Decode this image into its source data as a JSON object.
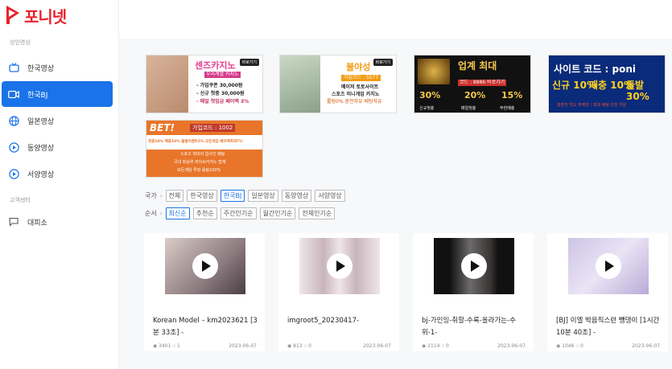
{
  "brand": {
    "logo_text": "포니넷",
    "accent": "#e8212b"
  },
  "sidebar": {
    "section1": "성인영상",
    "items": [
      {
        "label": "한국영상",
        "icon": "tv-icon"
      },
      {
        "label": "한국BJ",
        "icon": "video-camera-icon",
        "active": true
      },
      {
        "label": "일본영상",
        "icon": "globe-icon"
      },
      {
        "label": "동양영상",
        "icon": "play-circle-icon"
      },
      {
        "label": "서양영상",
        "icon": "play-circle-icon"
      }
    ],
    "section2": "고객센터",
    "support": {
      "label": "대피소",
      "icon": "chat-icon"
    }
  },
  "banners": [
    {
      "title": "센즈카지노",
      "sub": "우리계열 카지노",
      "lines": [
        "- 가입쿠폰 30,000원",
        "- 신규 첫충 30,000원",
        "- 매일 첫입금 페이백 3%"
      ],
      "btn": "바로가기"
    },
    {
      "title": "불야성",
      "sub": "가입코드 : 5577",
      "lines": [
        "메이저 토토사이트",
        "스포츠 미니게임 카지노",
        "롤링0% 완전자유 베팅자유"
      ],
      "btn": "바로가기"
    },
    {
      "title": "업계 최대",
      "sub": "코드 : 8886 바로가기",
      "lines": [
        "30%",
        "20%",
        "15%",
        "신규첫충",
        "매일첫충",
        "무한매충"
      ],
      "btn": ""
    },
    {
      "title": "사이트 코드 : poni",
      "sub": "",
      "lines": [
        "신규 10%",
        "매충 10%",
        "돌발 30%",
        "충환전 한도 무제한 / 최대 베팅 안전 지원"
      ],
      "btn": ""
    },
    {
      "title": "BET!",
      "sub": "가입코드 : 1002",
      "lines": [
        "첫충10% 매충10% 돌발이벤트5% 모든게임 페이백최대7%",
        "스포츠 최대의 업사인 배팅",
        "국내 최상위 라이브카지노 탑재",
        "모든게임 루징 롤링100%"
      ],
      "btn": ""
    }
  ],
  "filters": {
    "country_label": "국가",
    "country_options": [
      "전체",
      "한국영상",
      "한국BJ",
      "일본영상",
      "동양영상",
      "서양영상"
    ],
    "country_selected": 2,
    "order_label": "순서",
    "order_options": [
      "최신순",
      "추천순",
      "주간인기순",
      "월간인기순",
      "전체인기순"
    ],
    "order_selected": 0
  },
  "videos": [
    {
      "title": "Korean Model – km2023621 [3분 33초] -",
      "views": "3401",
      "likes": "1",
      "date": "2023-06-07"
    },
    {
      "title": "imgroot5_20230417-",
      "views": "813",
      "likes": "0",
      "date": "2023-06-07"
    },
    {
      "title": "bj-가인잉-취할-수록-올라가는-수위-1-",
      "views": "2114",
      "likes": "0",
      "date": "2023-06-07"
    },
    {
      "title": "[BJ] 이엘 박음직스런 뺑댕이 [1시간 10분 40초] -",
      "views": "1046",
      "likes": "0",
      "date": "2023-06-07"
    }
  ]
}
